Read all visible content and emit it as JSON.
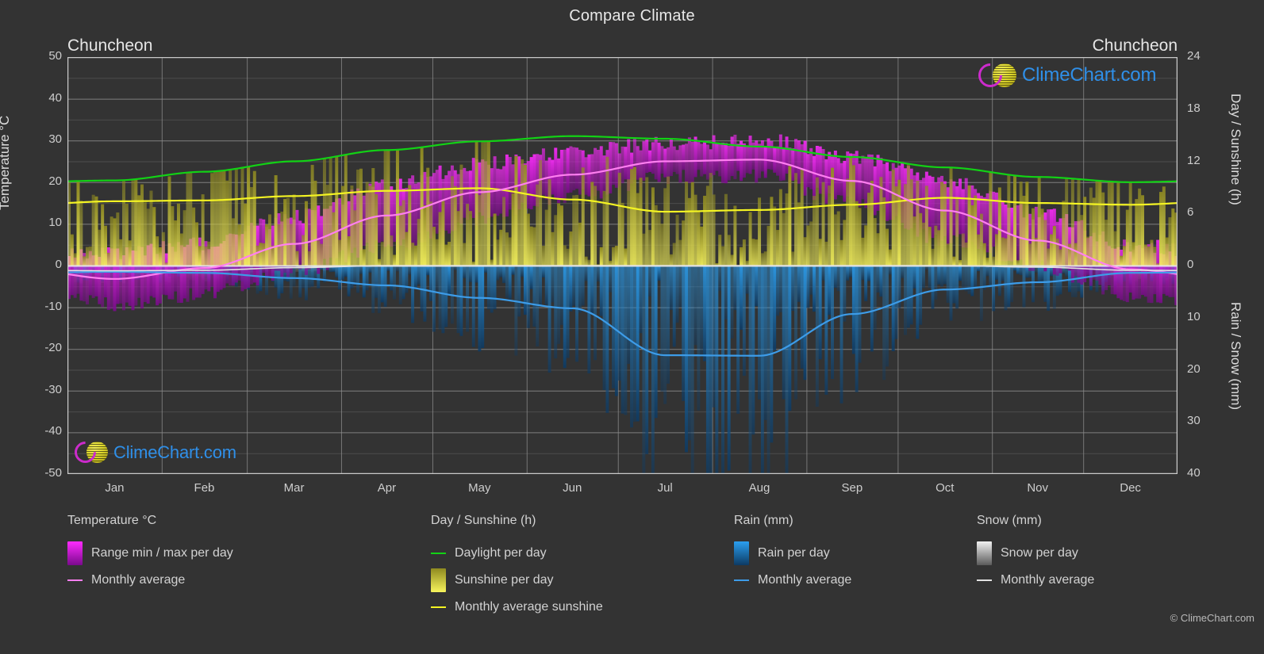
{
  "header": {
    "title": "Compare Climate",
    "location_left": "Chuncheon",
    "location_right": "Chuncheon"
  },
  "brand": {
    "name": "ClimeChart.com",
    "copyright": "© ClimeChart.com",
    "color": "#2f8fe8",
    "ring_color": "#cc2bcc",
    "ball_color": "#ded82e"
  },
  "axes": {
    "y_left_title": "Temperature °C",
    "y_right_title_top": "Day / Sunshine (h)",
    "y_right_title_bottom": "Rain / Snow (mm)",
    "y_left_ticks": [
      "50",
      "40",
      "30",
      "20",
      "10",
      "0",
      "-10",
      "-20",
      "-30",
      "-40",
      "-50"
    ],
    "y_right_ticks_top": [
      "24",
      "18",
      "12",
      "6",
      "0"
    ],
    "y_right_ticks_bottom": [
      "0",
      "10",
      "20",
      "30",
      "40"
    ],
    "x_ticks": [
      "Jan",
      "Feb",
      "Mar",
      "Apr",
      "May",
      "Jun",
      "Jul",
      "Aug",
      "Sep",
      "Oct",
      "Nov",
      "Dec"
    ]
  },
  "legend": {
    "columns": [
      {
        "heading": "Temperature °C",
        "items": [
          {
            "label": "Range min / max per day",
            "marker": "swatch",
            "color": "#e515e5"
          },
          {
            "label": "Monthly average",
            "marker": "line",
            "color": "#ff7ff0"
          }
        ]
      },
      {
        "heading": "Day / Sunshine (h)",
        "items": [
          {
            "label": "Daylight per day",
            "marker": "line",
            "color": "#12d215"
          },
          {
            "label": "Sunshine per day",
            "marker": "swatch",
            "color": "#eded46"
          },
          {
            "label": "Monthly average sunshine",
            "marker": "line",
            "color": "#f4f423"
          }
        ]
      },
      {
        "heading": "Rain (mm)",
        "items": [
          {
            "label": "Rain per day",
            "marker": "swatch",
            "color": "#1b82e0"
          },
          {
            "label": "Monthly average",
            "marker": "line",
            "color": "#3d9ce8"
          }
        ]
      },
      {
        "heading": "Snow (mm)",
        "items": [
          {
            "label": "Snow per day",
            "marker": "swatch",
            "color": "#dcdcdc"
          },
          {
            "label": "Monthly average",
            "marker": "line",
            "color": "#e2e2e2"
          }
        ]
      }
    ]
  },
  "chart_data": {
    "type": "area",
    "title": "Compare Climate",
    "subtitle": "Chuncheon",
    "xlabel": "",
    "ylabel": "Temperature °C",
    "ylim": [
      -50,
      50
    ],
    "y2_top_label": "Day / Sunshine (h)",
    "y2_top_lim": [
      0,
      24
    ],
    "y2_bottom_label": "Rain / Snow (mm)",
    "y2_bottom_lim": [
      0,
      40
    ],
    "grid": true,
    "legend_position": "bottom",
    "categories": [
      "Jan",
      "Feb",
      "Mar",
      "Apr",
      "May",
      "Jun",
      "Jul",
      "Aug",
      "Sep",
      "Oct",
      "Nov",
      "Dec"
    ],
    "series": [
      {
        "name": "Monthly average temperature",
        "units": "°C",
        "color": "#ff7ff0",
        "values": [
          -3.2,
          -0.6,
          5.2,
          12.0,
          17.6,
          21.8,
          25.0,
          25.4,
          20.3,
          13.2,
          6.0,
          -0.9
        ]
      },
      {
        "name": "Daily maximum temperature (range top)",
        "units": "°C",
        "color": "#e515e5",
        "values": [
          2.5,
          5.3,
          11.6,
          19.0,
          24.2,
          27.3,
          29.1,
          30.0,
          26.0,
          20.4,
          12.3,
          4.6
        ]
      },
      {
        "name": "Daily minimum temperature (range bottom)",
        "units": "°C",
        "color": "#a010a0",
        "values": [
          -9.3,
          -6.8,
          -1.2,
          4.8,
          11.0,
          16.8,
          21.3,
          21.6,
          14.8,
          6.2,
          -0.5,
          -7.1
        ]
      },
      {
        "name": "Daylight per day",
        "units": "h",
        "color": "#12d215",
        "values": [
          9.8,
          10.8,
          12.0,
          13.3,
          14.3,
          14.9,
          14.6,
          13.7,
          12.5,
          11.3,
          10.2,
          9.6
        ]
      },
      {
        "name": "Monthly average sunshine",
        "units": "h",
        "color": "#f4f423",
        "values": [
          7.4,
          7.5,
          8.0,
          8.6,
          8.9,
          7.6,
          6.2,
          6.4,
          7.0,
          7.8,
          7.2,
          7.0
        ]
      },
      {
        "name": "Monthly average rain",
        "units": "mm",
        "color": "#3d9ce8",
        "values": [
          1.2,
          1.4,
          2.4,
          3.8,
          6.2,
          8.2,
          17.2,
          17.3,
          9.3,
          4.6,
          3.2,
          1.4
        ]
      },
      {
        "name": "Monthly average snow",
        "units": "mm",
        "color": "#e2e2e2",
        "values": [
          1.0,
          0.9,
          0.4,
          0.0,
          0.0,
          0.0,
          0.0,
          0.0,
          0.0,
          0.0,
          0.3,
          0.9
        ]
      }
    ]
  }
}
